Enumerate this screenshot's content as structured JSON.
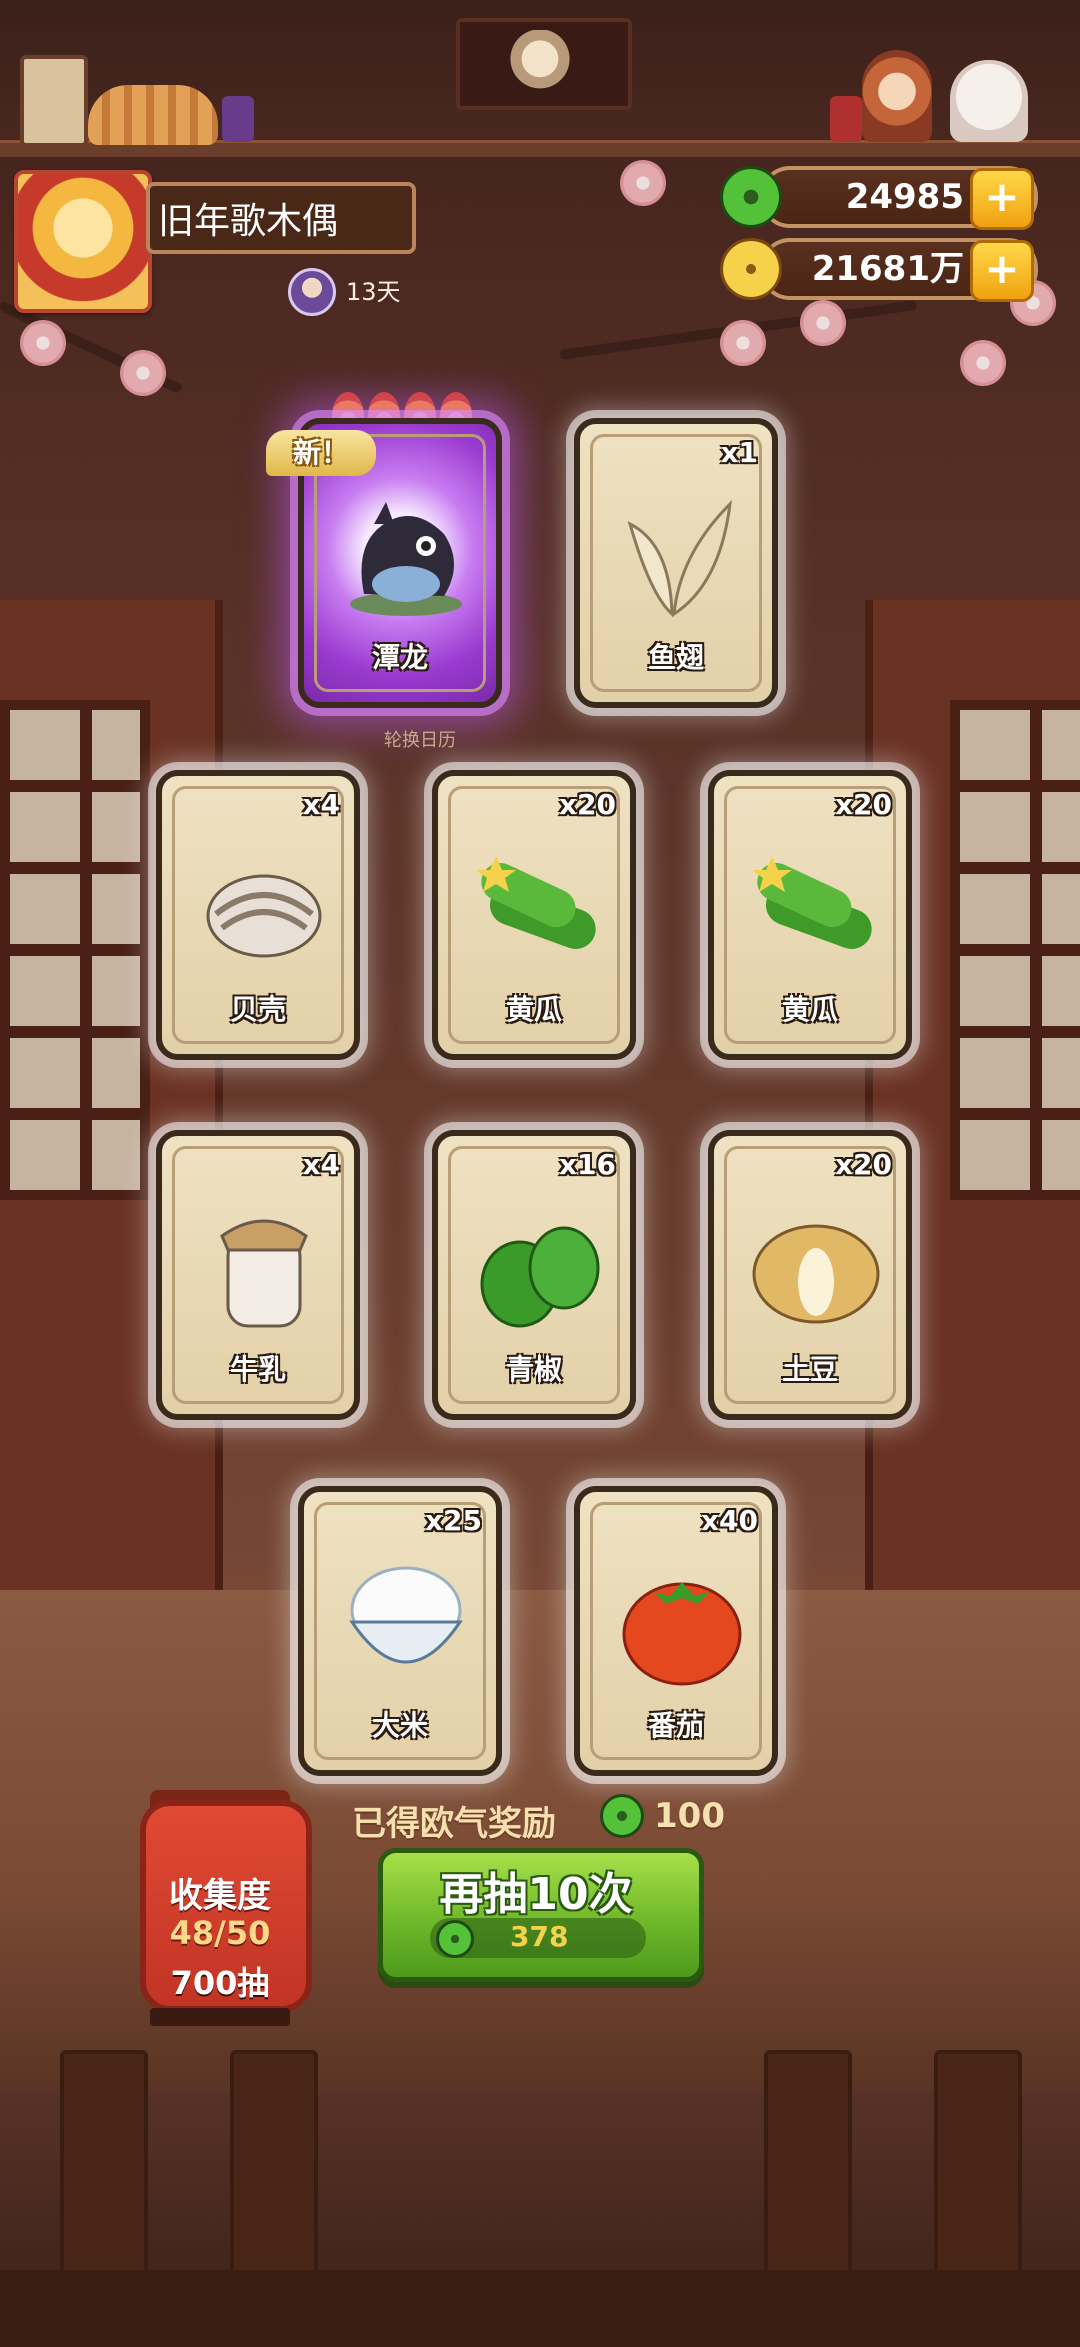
{
  "player": {
    "name": "旧年歌木偶",
    "time_left": "13天"
  },
  "currency": {
    "jade": "24985",
    "coins": "21681万"
  },
  "featured": [
    {
      "name": "潭龙",
      "new_tag": "新！",
      "flames": 4
    },
    {
      "name": "鱼翅",
      "qty": "x1"
    }
  ],
  "rotate_label": "轮换日历",
  "rows": [
    [
      {
        "name": "贝壳",
        "qty": "x4"
      },
      {
        "name": "黄瓜",
        "qty": "x20"
      },
      {
        "name": "黄瓜",
        "qty": "x20"
      }
    ],
    [
      {
        "name": "牛乳",
        "qty": "x4"
      },
      {
        "name": "青椒",
        "qty": "x16"
      },
      {
        "name": "土豆",
        "qty": "x20"
      }
    ],
    [
      {
        "name": "大米",
        "qty": "x25"
      },
      {
        "name": "番茄",
        "qty": "x40"
      }
    ]
  ],
  "collection": {
    "title": "收集度",
    "progress": "48/50",
    "draws": "700抽"
  },
  "reward": {
    "label": "已得欧气奖励",
    "value": "100"
  },
  "draw_button": {
    "label": "再抽10次",
    "cost": "378"
  },
  "colors": {
    "jade": "#54c238",
    "coin": "#f6d24a",
    "draw_button": "#6fb82a",
    "special_card": "#9a3ad0"
  }
}
